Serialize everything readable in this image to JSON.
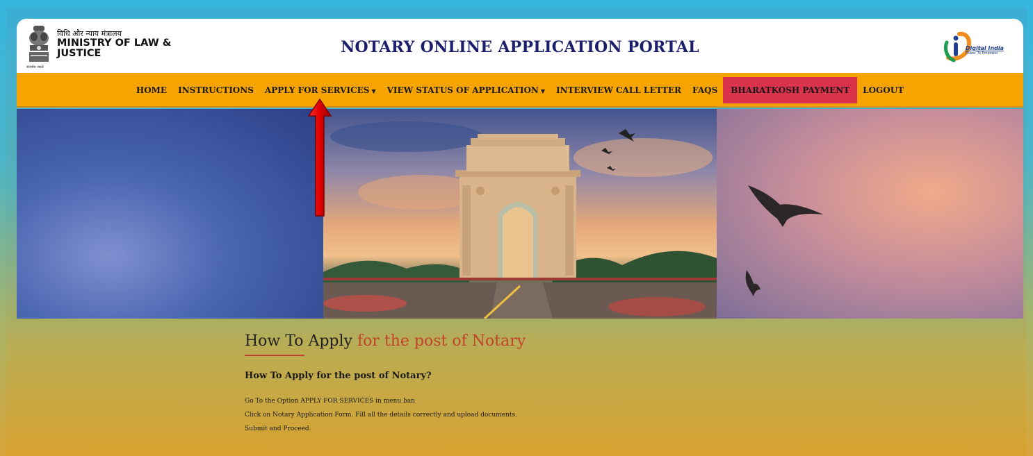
{
  "header": {
    "ministry_hindi": "विधि और न्याय मंत्रालय",
    "ministry_line1": "MINISTRY OF LAW &",
    "ministry_line2": "JUSTICE",
    "emblem_caption": "सत्यमेव जयते",
    "portal_title": "NOTARY ONLINE APPLICATION PORTAL",
    "digital_india_title": "Digital India",
    "digital_india_tagline": "Power To Empower"
  },
  "nav": {
    "items": [
      {
        "label": "HOME"
      },
      {
        "label": "INSTRUCTIONS"
      },
      {
        "label": "APPLY FOR SERVICES",
        "dropdown": true
      },
      {
        "label": "VIEW STATUS OF APPLICATION",
        "dropdown": true
      },
      {
        "label": "INTERVIEW CALL LETTER"
      },
      {
        "label": "FAQS"
      },
      {
        "label": "BHARATKOSH PAYMENT",
        "highlight_color": "#d9324a"
      },
      {
        "label": "LOGOUT"
      }
    ],
    "caret": "▼"
  },
  "content": {
    "title_main": "How To Apply ",
    "title_accent": "for the post of Notary",
    "subheading": "How To Apply for the post of Notary?",
    "steps": [
      "Go To the Option APPLY FOR SERVICES in menu ban",
      "Click on Notary Application Form. Fill all the details correctly and upload documents.",
      "Submit and Proceed."
    ]
  },
  "colors": {
    "navbar": "#f7a400",
    "title_navy": "#1b1f6b",
    "accent_red": "#c0442a",
    "annotation_arrow": "#e00000"
  },
  "icons": {
    "emblem": "national-emblem-icon",
    "digital_india": "digital-india-logo-icon",
    "annotation": "red-arrow-annotation-icon"
  }
}
